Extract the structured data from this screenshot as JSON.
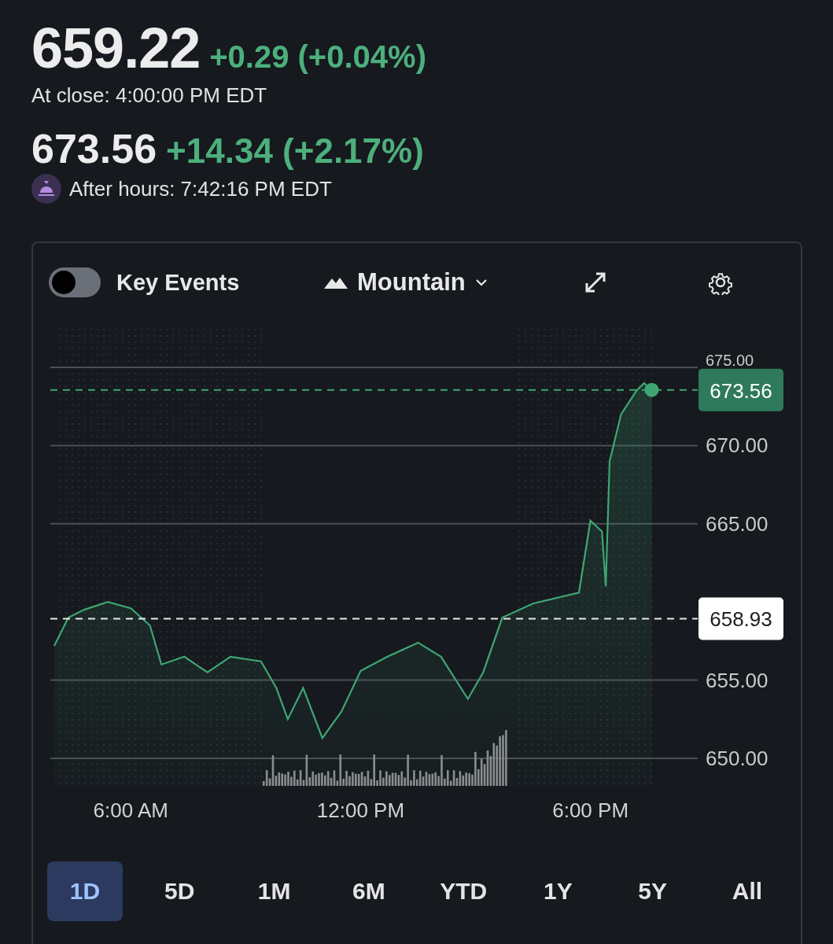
{
  "quote": {
    "price": "659.22",
    "change": "+0.29 (+0.04%)",
    "status": "At close: 4:00:00 PM EDT"
  },
  "after_hours": {
    "price": "673.56",
    "change": "+14.34 (+2.17%)",
    "status": "After hours: 7:42:16 PM EDT"
  },
  "toolbar": {
    "key_events": {
      "label": "Key Events",
      "on": false
    },
    "chart_type": "Mountain"
  },
  "chart": {
    "chart_data": {
      "type": "area",
      "series": [
        {
          "color": "#3fa672",
          "values": [
            657.2,
            659.0,
            659.5,
            660.0,
            659.6,
            658.5,
            656.0,
            656.5,
            655.5,
            656.5,
            656.2,
            654.5,
            652.5,
            654.5,
            651.3,
            653.0,
            655.6,
            656.5,
            657.4,
            656.5,
            653.8,
            655.5,
            659.0,
            659.9,
            660.6,
            665.2,
            664.5,
            661.0,
            669.0,
            672.0,
            673.5,
            674.0,
            673.56
          ]
        }
      ],
      "x": [
        4.0,
        4.37,
        4.78,
        5.4,
        6.0,
        6.5,
        6.8,
        7.4,
        8.0,
        8.6,
        9.4,
        9.8,
        10.1,
        10.5,
        11.0,
        11.5,
        12.0,
        12.7,
        13.5,
        14.1,
        14.8,
        15.2,
        15.7,
        16.5,
        17.7,
        18.0,
        18.3,
        18.4,
        18.5,
        18.8,
        19.2,
        19.4,
        19.6
      ],
      "xticks": [
        {
          "value": 6,
          "label": "6:00 AM"
        },
        {
          "value": 12,
          "label": "12:00 PM"
        },
        {
          "value": 18,
          "label": "6:00 PM"
        }
      ],
      "xlim": [
        3.9,
        20.8
      ],
      "ylim": [
        650,
        675
      ],
      "grid": true,
      "bands": [
        {
          "axis": "x",
          "from": 4.0,
          "to": 9.5
        },
        {
          "axis": "x",
          "from": 16.0,
          "to": 19.65
        }
      ],
      "ref_lines": [
        {
          "axis": "y",
          "value": 673.56,
          "label": "673.56",
          "color": "#3fa672"
        },
        {
          "axis": "y",
          "value": 658.93,
          "label": "658.93",
          "color": "#e8e8e8"
        }
      ],
      "yticks": [
        {
          "value": 650,
          "label": "650.00"
        },
        {
          "value": 655,
          "label": "655.00"
        },
        {
          "value": 665,
          "label": "665.00"
        },
        {
          "value": 670,
          "label": "670.00"
        },
        {
          "value": 675,
          "label": "675.00"
        }
      ]
    }
  },
  "ranges": [
    {
      "label": "1D",
      "selected": true
    },
    {
      "label": "5D",
      "selected": false
    },
    {
      "label": "1M",
      "selected": false
    },
    {
      "label": "6M",
      "selected": false
    },
    {
      "label": "YTD",
      "selected": false
    },
    {
      "label": "1Y",
      "selected": false
    },
    {
      "label": "5Y",
      "selected": false
    },
    {
      "label": "All",
      "selected": false
    }
  ]
}
